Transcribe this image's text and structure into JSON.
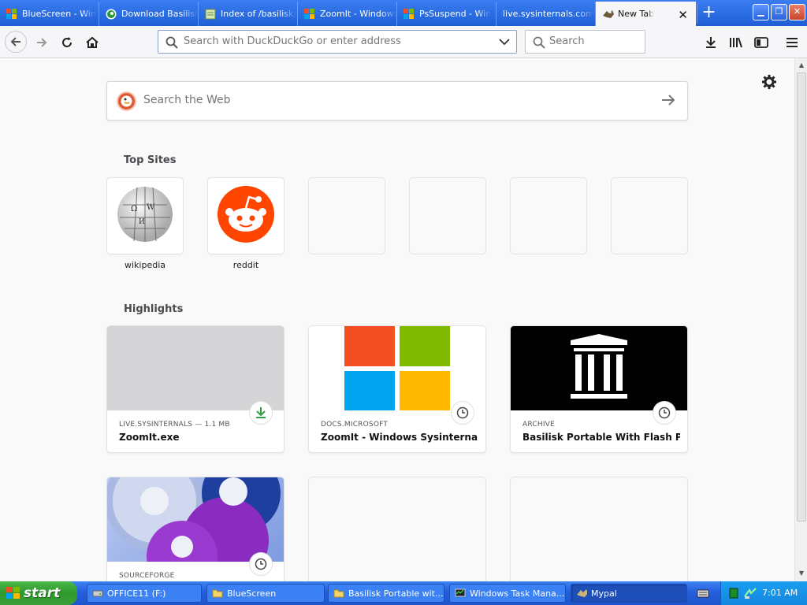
{
  "browser": {
    "tabs": [
      {
        "label": "BlueScreen - Win",
        "icon": "windows-logo-icon"
      },
      {
        "label": "Download Basilisk",
        "icon": "basilisk-icon"
      },
      {
        "label": "Index of /basilisk/",
        "icon": "page-icon"
      },
      {
        "label": "ZoomIt - Windows",
        "icon": "windows-logo-icon"
      },
      {
        "label": "PsSuspend - Win",
        "icon": "windows-logo-icon"
      },
      {
        "label": "live.sysinternals.com",
        "icon": "none"
      },
      {
        "label": "New Tab",
        "icon": "mypal-icon",
        "active": true
      }
    ],
    "url_placeholder": "Search with DuckDuckGo or enter address",
    "search_placeholder": "Search"
  },
  "newtab": {
    "web_search_placeholder": "Search the Web",
    "top_sites_title": "Top Sites",
    "top_sites": [
      {
        "label": "wikipedia"
      },
      {
        "label": "reddit"
      },
      {
        "label": ""
      },
      {
        "label": ""
      },
      {
        "label": ""
      },
      {
        "label": ""
      }
    ],
    "highlights_title": "Highlights",
    "highlights": [
      {
        "domain": "LIVE.SYSINTERNALS — 1.1 MB",
        "title": "ZoomIt.exe",
        "badge": "download-icon"
      },
      {
        "domain": "DOCS.MICROSOFT",
        "title": "ZoomIt - Windows Sysinternals |...",
        "badge": "clock-icon"
      },
      {
        "domain": "ARCHIVE",
        "title": "Basilisk Portable With Flash Play...",
        "badge": "clock-icon"
      },
      {
        "domain": "SOURCEFORGE",
        "title": "",
        "badge": "clock-icon"
      }
    ]
  },
  "taskbar": {
    "start_label": "start",
    "items": [
      {
        "label": "OFFICE11 (F:)"
      },
      {
        "label": "BlueScreen"
      },
      {
        "label": "Basilisk Portable wit..."
      },
      {
        "label": "Windows Task Mana..."
      },
      {
        "label": "Mypal"
      }
    ],
    "clock": "7:01 AM"
  },
  "colors": {
    "xp_blue": "#245edb",
    "start_green": "#3a9f38",
    "reddit_orange": "#ff4500",
    "ms_red": "#f25022",
    "ms_green": "#7fba00",
    "ms_blue": "#00a4ef",
    "ms_yellow": "#ffb900"
  }
}
